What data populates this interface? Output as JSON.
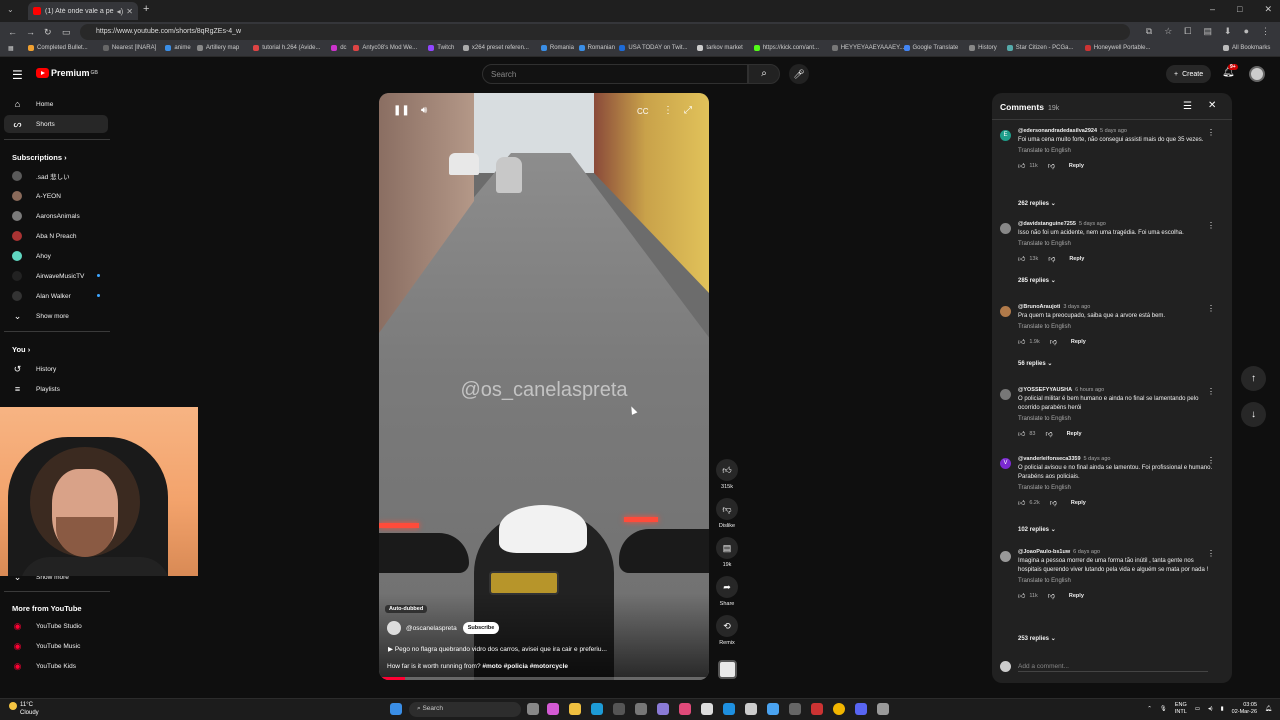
{
  "browser": {
    "tab_title": "(1) Até onde vale a pena fu",
    "url": "https://www.youtube.com/shorts/8qRgZEs-4_w",
    "window_controls": [
      "–",
      "□",
      "✕"
    ],
    "bookmarks": [
      "Completed Bullet...",
      "Nearest [INARA]",
      "anime",
      "Artillery map",
      "tutorial h.264 (Avide...",
      "dc",
      "Antyc08's Mod We...",
      "Twitch",
      "x264 preset referen...",
      "Romania",
      "Romanian",
      "USA TODAY on Twit...",
      "tarkov market",
      "https://kick.com/ant...",
      "HEYYEYAAEYAAAEY...",
      "Google Translate",
      "History",
      "Star Citizen - PCGa...",
      "Honeywell Portable..."
    ],
    "all_bookmarks": "All Bookmarks"
  },
  "youtube": {
    "logo_text": "Premium",
    "logo_sup": "GB",
    "search_placeholder": "Search",
    "create_label": "Create",
    "notif_count": "9+",
    "colors": {
      "brand": "#ff0000",
      "accent": "#3ea6ff",
      "progress": "#ff0033"
    }
  },
  "sidebar": {
    "home": "Home",
    "shorts": "Shorts",
    "subscriptions_heading": "Subscriptions",
    "subscriptions": [
      {
        "label": ".sad 悲しい",
        "color": "#5a5a5a",
        "dot": false
      },
      {
        "label": "A-YEON",
        "color": "#8a6a5a",
        "dot": false
      },
      {
        "label": "AaronsAnimals",
        "color": "#7a7a7a",
        "dot": false
      },
      {
        "label": "Aba N Preach",
        "color": "#a33",
        "dot": false
      },
      {
        "label": "Ahoy",
        "color": "#5fd6c0",
        "dot": false
      },
      {
        "label": "AirwaveMusicTV",
        "color": "#222",
        "dot": true
      },
      {
        "label": "Alan Walker",
        "color": "#333",
        "dot": true
      }
    ],
    "show_more": "Show more",
    "you_heading": "You",
    "history": "History",
    "playlists": "Playlists",
    "show_more_2": "Show more",
    "more_heading": "More from YouTube",
    "more_items": [
      "YouTube Studio",
      "YouTube Music",
      "YouTube Kids"
    ]
  },
  "video": {
    "watermark": "@os_canelaspreta",
    "auto_dubbed": "Auto-dubbed",
    "channel": "@oscanelaspreta",
    "subscribe": "Subscribe",
    "title": "Pego no flagra quebrando vidro dos carros, avisei que ira cair e preferiu...",
    "caption_prefix": "How far is it worth running from?",
    "caption_tags": "#moto #policia #motorcycle",
    "progress": 0.08
  },
  "actions": {
    "likes": "315k",
    "dislike": "Dislike",
    "comments": "19k",
    "share": "Share",
    "remix": "Remix"
  },
  "comments_panel": {
    "title": "Comments",
    "count": "19k",
    "add_placeholder": "Add a comment...",
    "reply_label": "Reply",
    "translate_label": "Translate to English",
    "items": [
      {
        "author": "@edersonandradedasilva2924",
        "time": "5 days ago",
        "text": "Foi uma cena muito forte, não consegui assisti mais do que 35 vezes.",
        "likes": "11k",
        "replies": "262 replies",
        "avatar": "E",
        "avatar_color": "#1e9e8a",
        "translate": true
      },
      {
        "author": "@davidstanguine7255",
        "time": "5 days ago",
        "text": "Isso não foi um acidente, nem uma tragédia. Foi uma escolha.",
        "likes": "13k",
        "replies": "285 replies",
        "avatar": "",
        "avatar_color": "#888",
        "translate": true
      },
      {
        "author": "@BrunoAraujoti",
        "time": "3 days ago",
        "text": "Pra quem ta preocupado, saiba que a arvore está bem.",
        "likes": "1.9k",
        "replies": "56 replies",
        "avatar": "",
        "avatar_color": "#b07a4a",
        "translate": true
      },
      {
        "author": "@YOSSEFYYAUSHA",
        "time": "6 hours ago",
        "text": "O policial militar é bem humano e ainda no final se lamentando pelo ocorrido parabéns herói",
        "likes": "83",
        "replies": "",
        "avatar": "",
        "avatar_color": "#777",
        "translate": true
      },
      {
        "author": "@vanderleifonseca3359",
        "time": "5 days ago",
        "text": "O policial avisou e no final ainda se lamentou. Foi profissional e humano. Parabéns aos policiais.",
        "likes": "6.2k",
        "replies": "102 replies",
        "avatar": "V",
        "avatar_color": "#7b2ad1",
        "translate": true
      },
      {
        "author": "@JoaoPaulo-bs1uw",
        "time": "6 days ago",
        "text": "Imagina a pessoa morrer de uma forma tão inútil , tanta gente nos hospitais querendo viver lutando pela vida e alguém se mata por nada !",
        "likes": "11k",
        "replies": "253 replies",
        "avatar": "",
        "avatar_color": "#999",
        "translate": true
      }
    ]
  },
  "taskbar": {
    "temp": "11°C",
    "weather": "Cloudy",
    "search": "Search",
    "lang": "ENG",
    "lang2": "INTL",
    "time": "03:05",
    "date": "02-Mar-26"
  }
}
